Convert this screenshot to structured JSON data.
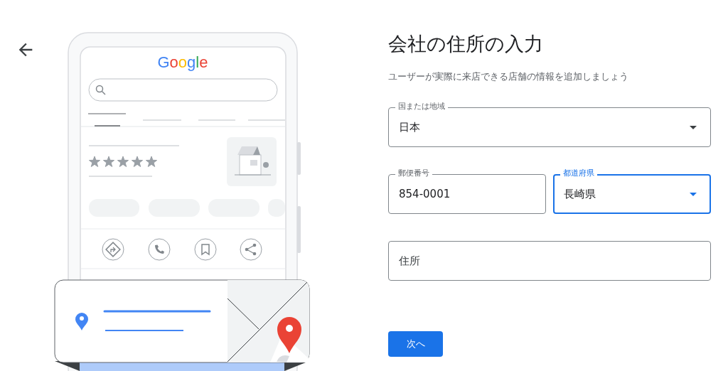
{
  "illustration": {
    "logo": "Google",
    "stars": 5
  },
  "title": "会社の住所の入力",
  "subtitle": "ユーザーが実際に来店できる店舗の情報を追加しましょう",
  "field_rows": [
    [
      {
        "kind": "select",
        "label": "国または地域",
        "value": "日本",
        "focused": false
      }
    ],
    [
      {
        "kind": "text",
        "label": "郵便番号",
        "value": "854-0001",
        "focused": false
      },
      {
        "kind": "select",
        "label": "都道府県",
        "value": "長崎県",
        "focused": true
      }
    ],
    [
      {
        "kind": "text",
        "placeholder": "住所",
        "focused": false
      }
    ]
  ],
  "next_button": "次へ"
}
